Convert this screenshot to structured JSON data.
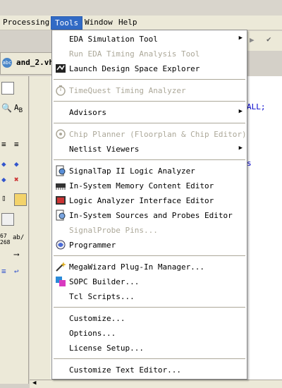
{
  "menubar": {
    "processing": "Processing",
    "tools": "Tools",
    "window": "Window",
    "help": "Help"
  },
  "doc_tab": {
    "name": "and_2.vh",
    "icon": "abc"
  },
  "code_fragments": [
    "ALL;",
    "s"
  ],
  "tool_labels": {
    "a": "ab/",
    "b": "67",
    "c": "268"
  },
  "menu": {
    "items": [
      {
        "label": "EDA Simulation Tool",
        "submenu": true,
        "disabled": false,
        "icon": "none"
      },
      {
        "label": "Run EDA Timing Analysis Tool",
        "submenu": false,
        "disabled": true,
        "icon": "none"
      },
      {
        "label": "Launch Design Space Explorer",
        "submenu": false,
        "disabled": false,
        "icon": "dse-icon"
      },
      {
        "label": "TimeQuest Timing Analyzer",
        "submenu": false,
        "disabled": true,
        "icon": "stopwatch-icon"
      },
      {
        "label": "Advisors",
        "submenu": true,
        "disabled": false,
        "icon": "none"
      },
      {
        "label": "Chip Planner (Floorplan & Chip Editor)",
        "submenu": false,
        "disabled": true,
        "icon": "chip-planner-icon"
      },
      {
        "label": "Netlist Viewers",
        "submenu": true,
        "disabled": false,
        "icon": "none"
      },
      {
        "label": "SignalTap II Logic Analyzer",
        "submenu": false,
        "disabled": false,
        "icon": "signaltap-icon"
      },
      {
        "label": "In-System Memory Content Editor",
        "submenu": false,
        "disabled": false,
        "icon": "memory-icon"
      },
      {
        "label": "Logic Analyzer Interface Editor",
        "submenu": false,
        "disabled": false,
        "icon": "logic-analyzer-icon"
      },
      {
        "label": "In-System Sources and Probes Editor",
        "submenu": false,
        "disabled": false,
        "icon": "probes-icon"
      },
      {
        "label": "SignalProbe Pins...",
        "submenu": false,
        "disabled": true,
        "icon": "none"
      },
      {
        "label": "Programmer",
        "submenu": false,
        "disabled": false,
        "icon": "programmer-icon"
      },
      {
        "label": "MegaWizard Plug-In Manager...",
        "submenu": false,
        "disabled": false,
        "icon": "megawizard-icon"
      },
      {
        "label": "SOPC Builder...",
        "submenu": false,
        "disabled": false,
        "icon": "sopc-icon"
      },
      {
        "label": "Tcl Scripts...",
        "submenu": false,
        "disabled": false,
        "icon": "none"
      },
      {
        "label": "Customize...",
        "submenu": false,
        "disabled": false,
        "icon": "none"
      },
      {
        "label": "Options...",
        "submenu": false,
        "disabled": false,
        "icon": "none"
      },
      {
        "label": "License Setup...",
        "submenu": false,
        "disabled": false,
        "icon": "none"
      },
      {
        "label": "Customize Text Editor...",
        "submenu": false,
        "disabled": false,
        "icon": "none"
      }
    ]
  },
  "colors": {
    "highlight": "#316ac5",
    "disabled_text": "#aca899",
    "menu_bg": "#ffffff"
  }
}
